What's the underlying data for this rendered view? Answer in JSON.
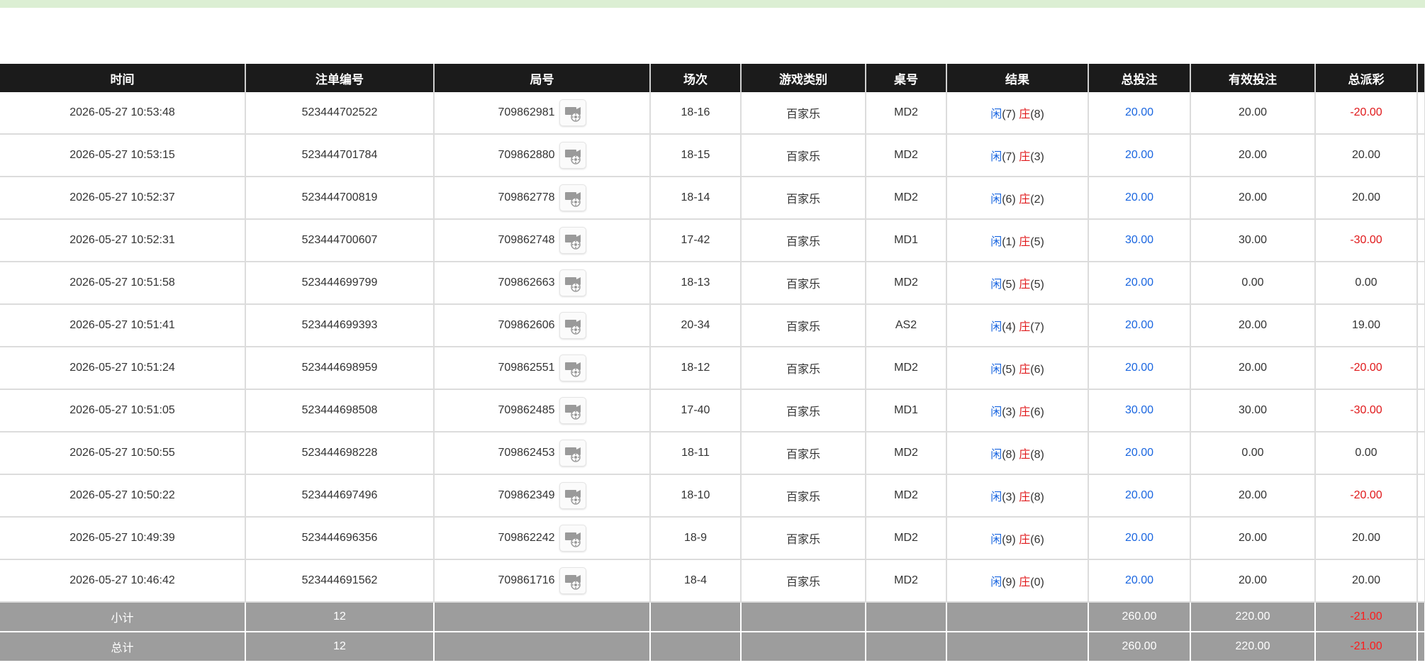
{
  "columns": [
    "时间",
    "注单编号",
    "局号",
    "场次",
    "游戏类别",
    "桌号",
    "结果",
    "总投注",
    "有效投注",
    "总派彩"
  ],
  "result_labels": {
    "player": "闲",
    "banker": "庄"
  },
  "rows": [
    {
      "time": "2026-05-27 10:53:48",
      "order": "523444702522",
      "round": "709862981",
      "scene": "18-16",
      "game": "百家乐",
      "table": "MD2",
      "player": "(7)",
      "banker": "(8)",
      "total": "20.00",
      "valid": "20.00",
      "payout": "-20.00"
    },
    {
      "time": "2026-05-27 10:53:15",
      "order": "523444701784",
      "round": "709862880",
      "scene": "18-15",
      "game": "百家乐",
      "table": "MD2",
      "player": "(7)",
      "banker": "(3)",
      "total": "20.00",
      "valid": "20.00",
      "payout": "20.00"
    },
    {
      "time": "2026-05-27 10:52:37",
      "order": "523444700819",
      "round": "709862778",
      "scene": "18-14",
      "game": "百家乐",
      "table": "MD2",
      "player": "(6)",
      "banker": "(2)",
      "total": "20.00",
      "valid": "20.00",
      "payout": "20.00"
    },
    {
      "time": "2026-05-27 10:52:31",
      "order": "523444700607",
      "round": "709862748",
      "scene": "17-42",
      "game": "百家乐",
      "table": "MD1",
      "player": "(1)",
      "banker": "(5)",
      "total": "30.00",
      "valid": "30.00",
      "payout": "-30.00"
    },
    {
      "time": "2026-05-27 10:51:58",
      "order": "523444699799",
      "round": "709862663",
      "scene": "18-13",
      "game": "百家乐",
      "table": "MD2",
      "player": "(5)",
      "banker": "(5)",
      "total": "20.00",
      "valid": "0.00",
      "payout": "0.00"
    },
    {
      "time": "2026-05-27 10:51:41",
      "order": "523444699393",
      "round": "709862606",
      "scene": "20-34",
      "game": "百家乐",
      "table": "AS2",
      "player": "(4)",
      "banker": "(7)",
      "total": "20.00",
      "valid": "20.00",
      "payout": "19.00"
    },
    {
      "time": "2026-05-27 10:51:24",
      "order": "523444698959",
      "round": "709862551",
      "scene": "18-12",
      "game": "百家乐",
      "table": "MD2",
      "player": "(5)",
      "banker": "(6)",
      "total": "20.00",
      "valid": "20.00",
      "payout": "-20.00"
    },
    {
      "time": "2026-05-27 10:51:05",
      "order": "523444698508",
      "round": "709862485",
      "scene": "17-40",
      "game": "百家乐",
      "table": "MD1",
      "player": "(3)",
      "banker": "(6)",
      "total": "30.00",
      "valid": "30.00",
      "payout": "-30.00"
    },
    {
      "time": "2026-05-27 10:50:55",
      "order": "523444698228",
      "round": "709862453",
      "scene": "18-11",
      "game": "百家乐",
      "table": "MD2",
      "player": "(8)",
      "banker": "(8)",
      "total": "20.00",
      "valid": "0.00",
      "payout": "0.00"
    },
    {
      "time": "2026-05-27 10:50:22",
      "order": "523444697496",
      "round": "709862349",
      "scene": "18-10",
      "game": "百家乐",
      "table": "MD2",
      "player": "(3)",
      "banker": "(8)",
      "total": "20.00",
      "valid": "20.00",
      "payout": "-20.00"
    },
    {
      "time": "2026-05-27 10:49:39",
      "order": "523444696356",
      "round": "709862242",
      "scene": "18-9",
      "game": "百家乐",
      "table": "MD2",
      "player": "(9)",
      "banker": "(6)",
      "total": "20.00",
      "valid": "20.00",
      "payout": "20.00"
    },
    {
      "time": "2026-05-27 10:46:42",
      "order": "523444691562",
      "round": "709861716",
      "scene": "18-4",
      "game": "百家乐",
      "table": "MD2",
      "player": "(9)",
      "banker": "(0)",
      "total": "20.00",
      "valid": "20.00",
      "payout": "20.00"
    }
  ],
  "subtotal": {
    "label": "小计",
    "count": "12",
    "total": "260.00",
    "valid": "220.00",
    "payout": "-21.00"
  },
  "grandtotal": {
    "label": "总计",
    "count": "12",
    "total": "260.00",
    "valid": "220.00",
    "payout": "-21.00"
  },
  "icons": {
    "replay": "video-replay-icon"
  },
  "colors": {
    "header_bg": "#1b1b1b",
    "footer_bg": "#9d9d9d",
    "blue": "#1a66e0",
    "red": "#e0191b",
    "topbar": "#dcefd3"
  }
}
